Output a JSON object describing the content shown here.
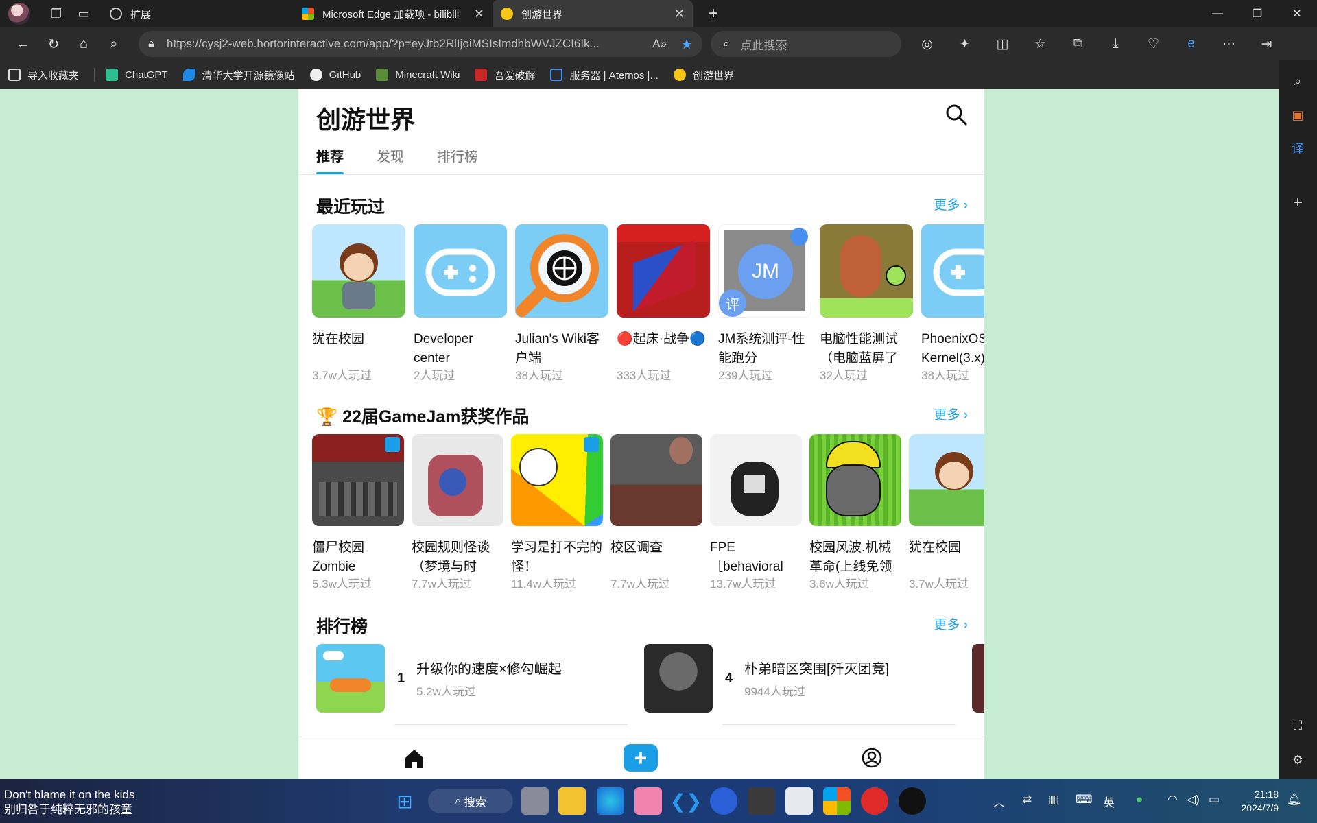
{
  "browser": {
    "tabs": [
      {
        "label": "扩展",
        "active": false
      },
      {
        "label": "Microsoft Edge 加载项 - bilibili",
        "active": false
      },
      {
        "label": "创游世界",
        "active": true
      }
    ],
    "url": "https://cysj2-web.hortorinteractive.com/app/?p=eyJtb2RlIjoiMSIsImdhbWVJZCI6Ik...",
    "search_placeholder": "点此搜索",
    "bookmarks": [
      {
        "label": "导入收藏夹"
      },
      {
        "label": "ChatGPT"
      },
      {
        "label": "清华大学开源镜像站"
      },
      {
        "label": "GitHub"
      },
      {
        "label": "Minecraft Wiki"
      },
      {
        "label": "吾爱破解"
      },
      {
        "label": "服务器 | Aternos |..."
      },
      {
        "label": "创游世界"
      }
    ]
  },
  "app": {
    "title": "创游世界",
    "tabs": [
      "推荐",
      "发现",
      "排行榜"
    ],
    "more_label": "更多",
    "recent": {
      "title": "最近玩过",
      "items": [
        {
          "title": "犹在校园",
          "plays": "3.7w人玩过"
        },
        {
          "title": "Developer center",
          "plays": "2人玩过"
        },
        {
          "title": "Julian's Wiki客户端",
          "plays": "38人玩过"
        },
        {
          "title": "🔴起床·战争🔵",
          "plays": "333人玩过"
        },
        {
          "title": "JM系统测评-性能跑分",
          "plays": "239人玩过"
        },
        {
          "title": "电脑性能测试（电脑蓝屏了",
          "plays": "32人玩过"
        },
        {
          "title": "PhoenixOS Kernel(3.x)",
          "plays": "38人玩过"
        }
      ]
    },
    "gamejam": {
      "title": "🏆 22届GameJam获奖作品",
      "items": [
        {
          "title": "僵尸校园Zombie",
          "plays": "5.3w人玩过"
        },
        {
          "title": "校园规则怪谈（梦境与时",
          "plays": "7.7w人玩过"
        },
        {
          "title": "学习是打不完的怪！",
          "plays": "11.4w人玩过"
        },
        {
          "title": "校区调查",
          "plays": "7.7w人玩过"
        },
        {
          "title": "FPE［behavioral",
          "plays": "13.7w人玩过"
        },
        {
          "title": "校园风波.机械革命(上线免领",
          "plays": "3.6w人玩过"
        },
        {
          "title": "犹在校园",
          "plays": "3.7w人玩过"
        }
      ]
    },
    "ranking": {
      "title": "排行榜",
      "items": [
        {
          "rank": "1",
          "title": "升级你的速度×修勾崛起",
          "plays": "5.2w人玩过"
        },
        {
          "rank": "4",
          "title": "朴弟暗区突围[歼灭团竞]",
          "plays": "9944人玩过"
        }
      ]
    }
  },
  "taskbar": {
    "media_line1": "Don't blame it on the kids",
    "media_line2": "别归咎于纯粹无邪的孩童",
    "search_label": "搜索",
    "ime": "英",
    "time": "21:18",
    "date": "2024/7/9"
  },
  "colors": {
    "accent": "#1a9fe6",
    "page_bg": "#c6ecd1"
  }
}
